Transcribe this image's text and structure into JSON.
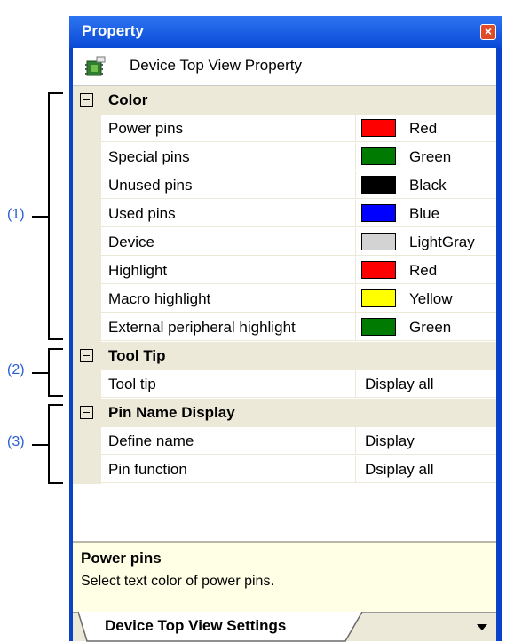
{
  "window": {
    "title": "Property",
    "header_label": "Device Top View Property",
    "close_icon": "close-icon"
  },
  "annotations": [
    "(1)",
    "(2)",
    "(3)"
  ],
  "categories": {
    "color": {
      "label": "Color",
      "items": [
        {
          "name": "Power pins",
          "value": "Red",
          "color": "#ff0000"
        },
        {
          "name": "Special pins",
          "value": "Green",
          "color": "#007a00"
        },
        {
          "name": "Unused pins",
          "value": "Black",
          "color": "#000000"
        },
        {
          "name": "Used pins",
          "value": "Blue",
          "color": "#0000ff"
        },
        {
          "name": "Device",
          "value": "LightGray",
          "color": "#d3d3d3"
        },
        {
          "name": "Highlight",
          "value": "Red",
          "color": "#ff0000"
        },
        {
          "name": "Macro highlight",
          "value": "Yellow",
          "color": "#ffff00"
        },
        {
          "name": "External peripheral highlight",
          "value": "Green",
          "color": "#007a00"
        }
      ]
    },
    "tooltip": {
      "label": "Tool Tip",
      "items": [
        {
          "name": "Tool tip",
          "value": "Display all"
        }
      ]
    },
    "pin_name": {
      "label": "Pin Name Display",
      "items": [
        {
          "name": "Define name",
          "value": "Display"
        },
        {
          "name": "Pin function",
          "value": "Dsiplay all"
        }
      ]
    }
  },
  "description": {
    "title": "Power pins",
    "text": "Select text color of power pins."
  },
  "tabs": {
    "active": "Device Top View Settings"
  },
  "colors": {
    "titlebar": "#0a4ad6",
    "annotation": "#2b5fd4",
    "description_bg": "#ffffe6"
  }
}
